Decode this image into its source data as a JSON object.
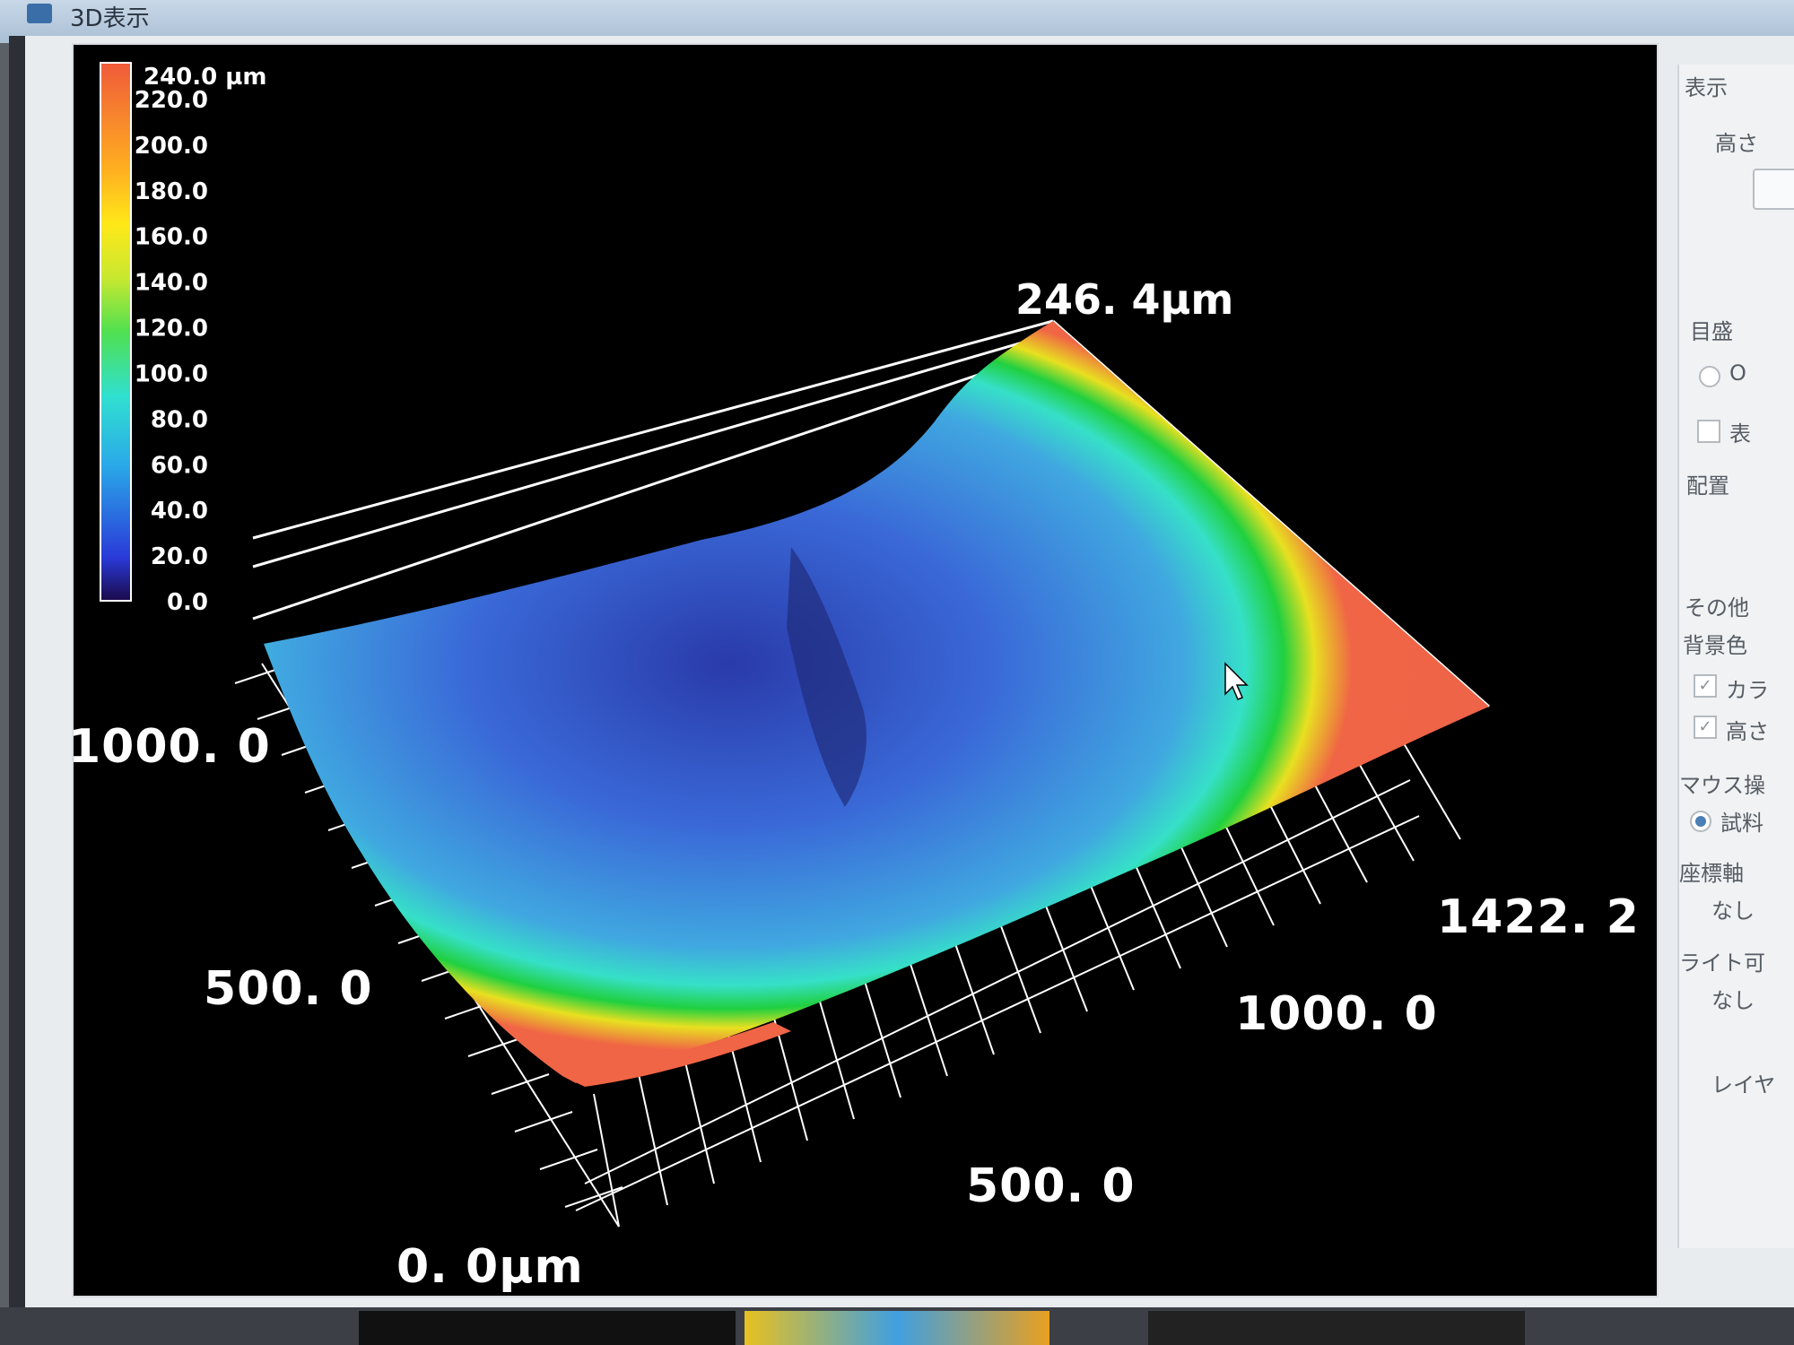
{
  "window": {
    "title": "3D表示"
  },
  "colorbar": {
    "top_label": "240.0 µm",
    "ticks": [
      "220.0",
      "200.0",
      "180.0",
      "160.0",
      "140.0",
      "120.0",
      "100.0",
      "80.0",
      "60.0",
      "40.0",
      "20.0",
      "0.0"
    ]
  },
  "axes": {
    "peak": "246. 4µm",
    "origin": "0. 0µm",
    "x_500": "500. 0",
    "x_1000": "1000. 0",
    "x_max": "1422. 2",
    "y_500": "500. 0",
    "y_1000": "1000. 0"
  },
  "side_panel": {
    "display_settings": "表示",
    "height_label": "高さ",
    "scale_label": "目盛",
    "scale_option": "O",
    "scale_checkbox": "表",
    "arrangement_label": "配置",
    "other_label": "その他",
    "background_label": "背景色",
    "color_check": "カラ",
    "height_check": "高さ",
    "mouse_label": "マウス操",
    "mouse_option": "試料",
    "axis_label": "座標軸",
    "axis_value": "なし",
    "light_label": "ライト可",
    "light_value": "なし",
    "layer_label": "レイヤ"
  },
  "colors": {
    "high": "#f06545",
    "mid": "#22cc44",
    "low": "#4a7de0",
    "background": "#000000"
  }
}
